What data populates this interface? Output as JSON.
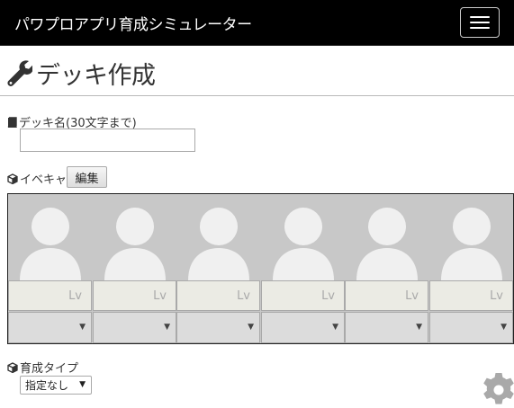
{
  "navbar": {
    "brand": "パワプロアプリ育成シミュレーター",
    "menu_icon": "hamburger-menu-icon"
  },
  "page": {
    "title": "デッキ作成",
    "title_icon": "wrench-icon"
  },
  "deck_name": {
    "label": "デッキ名(30文字まで)",
    "icon": "book-icon",
    "value": ""
  },
  "event_chars": {
    "label": "イベキャラ",
    "icon": "cube-icon",
    "edit_label": "編集",
    "slots": [
      {
        "lv": "Lv",
        "select_arrow": "▼"
      },
      {
        "lv": "Lv",
        "select_arrow": "▼"
      },
      {
        "lv": "Lv",
        "select_arrow": "▼"
      },
      {
        "lv": "Lv",
        "select_arrow": "▼"
      },
      {
        "lv": "Lv",
        "select_arrow": "▼"
      },
      {
        "lv": "Lv",
        "select_arrow": "▼"
      }
    ]
  },
  "training_type": {
    "label": "育成タイプ",
    "icon": "cube-icon",
    "selected": "指定なし",
    "caret": "▼"
  },
  "settings": {
    "icon": "gear-icon"
  },
  "colors": {
    "navbar": "#000000",
    "portrait_bg": "#c8c8c8",
    "silhouette": "#f0f0f0",
    "lv_bg": "#ebebe4"
  }
}
